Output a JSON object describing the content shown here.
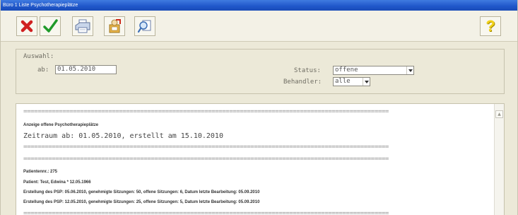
{
  "window": {
    "title": "Büro 1 Liste Psychotherapieplätze"
  },
  "toolbar": {
    "cancel": "cancel-icon",
    "ok": "checkmark-icon",
    "print": "printer-icon",
    "export": "export-icon",
    "search": "search-icon",
    "help": "help-icon",
    "help_glyph": "?"
  },
  "filter": {
    "group_label": "Auswahl:",
    "ab_label": "ab:",
    "ab_value": "01.05.2010",
    "status_label": "Status:",
    "status_value": "offene",
    "behandler_label": "Behandler:",
    "behandler_value": "alle"
  },
  "report": {
    "separator": "=======================================================================================================",
    "heading": "Anzeige offene Psychotherapieplätze",
    "zeitraum": "Zeitraum ab: 01.05.2010, erstellt am 15.10.2010",
    "patientennr": "Patientennr.: 275",
    "patient": "Patient: Test, Edwina * 12.05.1966",
    "erst1": "Erstellung des PSP: 05.06.2010, genehmigte Sitzungen: 50, offene Sitzungen: 6, Datum letzte Bearbeitung: 05.09.2010",
    "erst2": "Erstellung des PSP: 12.05.2010, genehmigte Sitzungen: 25, offene Sitzungen: 5, Datum letzte Bearbeitung: 05.09.2010"
  },
  "colors": {
    "titlebar": "#2457cc",
    "window_bg": "#ece9d8",
    "cancel_red": "#d02020",
    "ok_green": "#1f9a2a",
    "help_yellow": "#f2d21a"
  }
}
